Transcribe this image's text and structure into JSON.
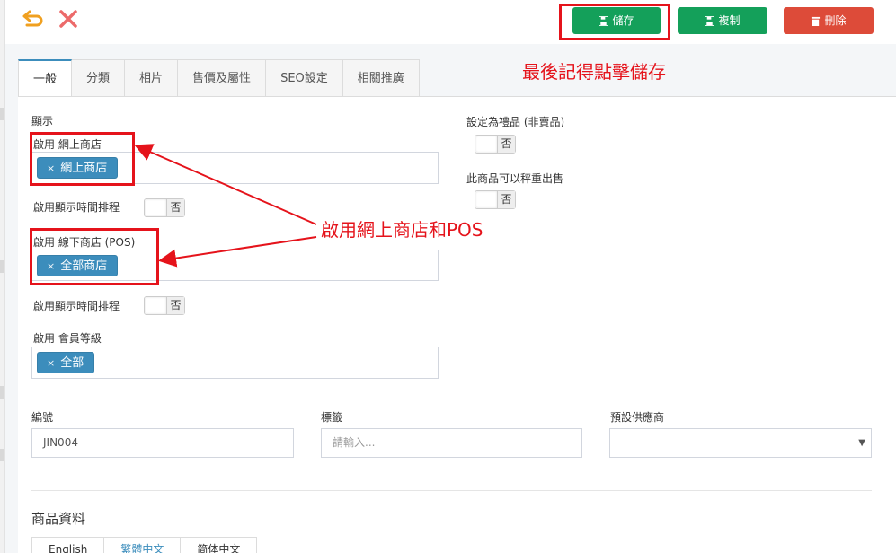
{
  "toolbar": {
    "undo_icon": "undo-arrow-icon",
    "close_icon": "close-x-icon",
    "save_label": "儲存",
    "copy_label": "複制",
    "delete_label": "刪除",
    "save_color": "#14a05a",
    "delete_color": "#dd4b39"
  },
  "tabs": [
    {
      "label": "一般",
      "active": true
    },
    {
      "label": "分類"
    },
    {
      "label": "相片"
    },
    {
      "label": "售價及屬性"
    },
    {
      "label": "SEO設定"
    },
    {
      "label": "相關推廣"
    }
  ],
  "display": {
    "section_label": "顯示",
    "online_store_label": "啟用 網上商店",
    "online_store_chip": "網上商店",
    "schedule_label_1": "啟用顯示時間排程",
    "schedule_value_1": "否",
    "pos_label": "啟用 線下商店 (POS)",
    "pos_chip": "全部商店",
    "schedule_label_2": "啟用顯示時間排程",
    "schedule_value_2": "否",
    "member_label": "啟用 會員等級",
    "member_chip": "全部"
  },
  "right_settings": {
    "gift_label": "設定為禮品 (非賣品)",
    "gift_value": "否",
    "weigh_label": "此商品可以秤重出售",
    "weigh_value": "否"
  },
  "fields": {
    "code_label": "編號",
    "code_value": "JIN004",
    "tag_label": "標籤",
    "tag_placeholder": "請輸入...",
    "supplier_label": "預設供應商",
    "supplier_value": ""
  },
  "product_info": {
    "title": "商品資料",
    "lang_tabs": [
      "English",
      "繁體中文",
      "简体中文"
    ]
  },
  "annotations": {
    "save_note": "最後記得點擊儲存",
    "enable_note": "啟用網上商店和POS",
    "color": "#e5131b"
  }
}
